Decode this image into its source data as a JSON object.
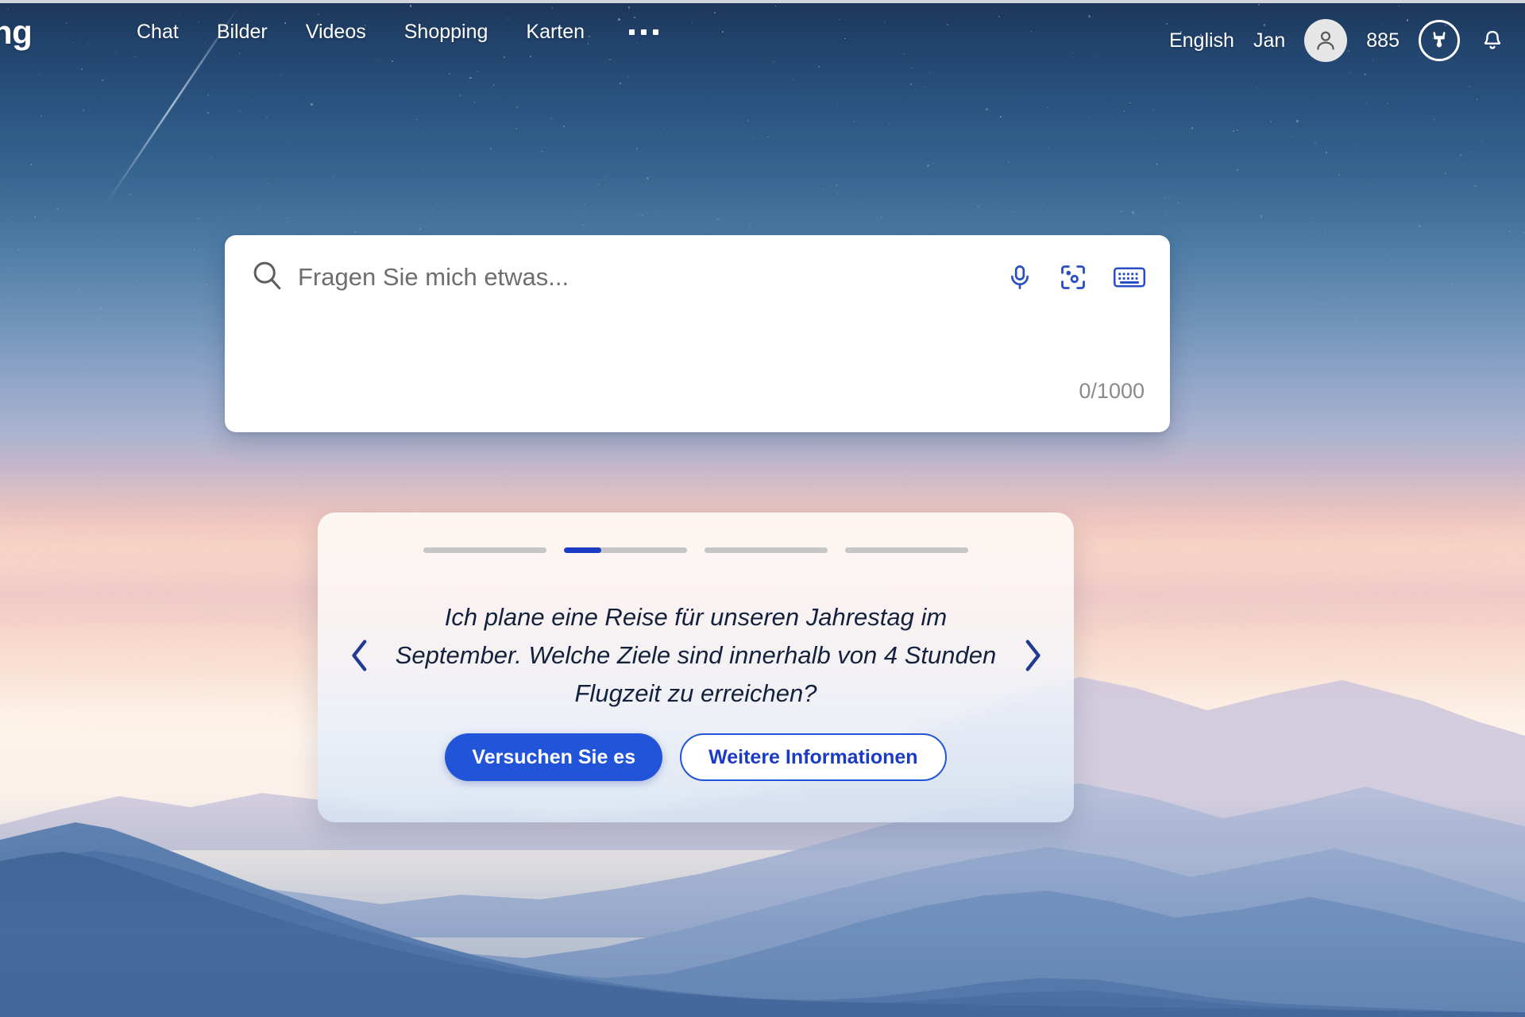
{
  "header": {
    "logo_text": "ng",
    "nav_items": [
      {
        "label": "Chat",
        "name": "nav-chat"
      },
      {
        "label": "Bilder",
        "name": "nav-bilder"
      },
      {
        "label": "Videos",
        "name": "nav-videos"
      },
      {
        "label": "Shopping",
        "name": "nav-shopping"
      },
      {
        "label": "Karten",
        "name": "nav-karten"
      }
    ],
    "more_label": "more-menu",
    "language": "English",
    "user_name": "Jan",
    "rewards_points": "885",
    "icons": {
      "avatar": "person-icon",
      "rewards": "rewards-medal-icon",
      "notifications": "bell-icon",
      "more": "ellipsis-icon"
    }
  },
  "search": {
    "placeholder": "Fragen Sie mich etwas...",
    "value": "",
    "counter": "0/1000",
    "icons": {
      "search": "search-icon",
      "mic": "microphone-icon",
      "lens": "visual-search-camera-icon",
      "keyboard": "keyboard-icon"
    }
  },
  "carousel": {
    "slides_total": 4,
    "active_index": 1,
    "active_fill_percent": 30,
    "prompt": "Ich plane eine Reise für unseren Jahrestag im September. Welche Ziele sind innerhalb von 4 Stunden Flugzeit zu erreichen?",
    "primary_button": "Versuchen Sie es",
    "secondary_button": "Weitere Informationen",
    "prev_label": "chevron-left-icon",
    "next_label": "chevron-right-icon"
  },
  "colors": {
    "accent_blue": "#2154d8",
    "deep_blue": "#1b3bc4",
    "prompt_text": "#14213d",
    "progress_track": "#c6c6c6",
    "counter_text": "#8a8a8a",
    "sky_top": "#1d3557",
    "sky_horizon": "#fbf1ea"
  }
}
